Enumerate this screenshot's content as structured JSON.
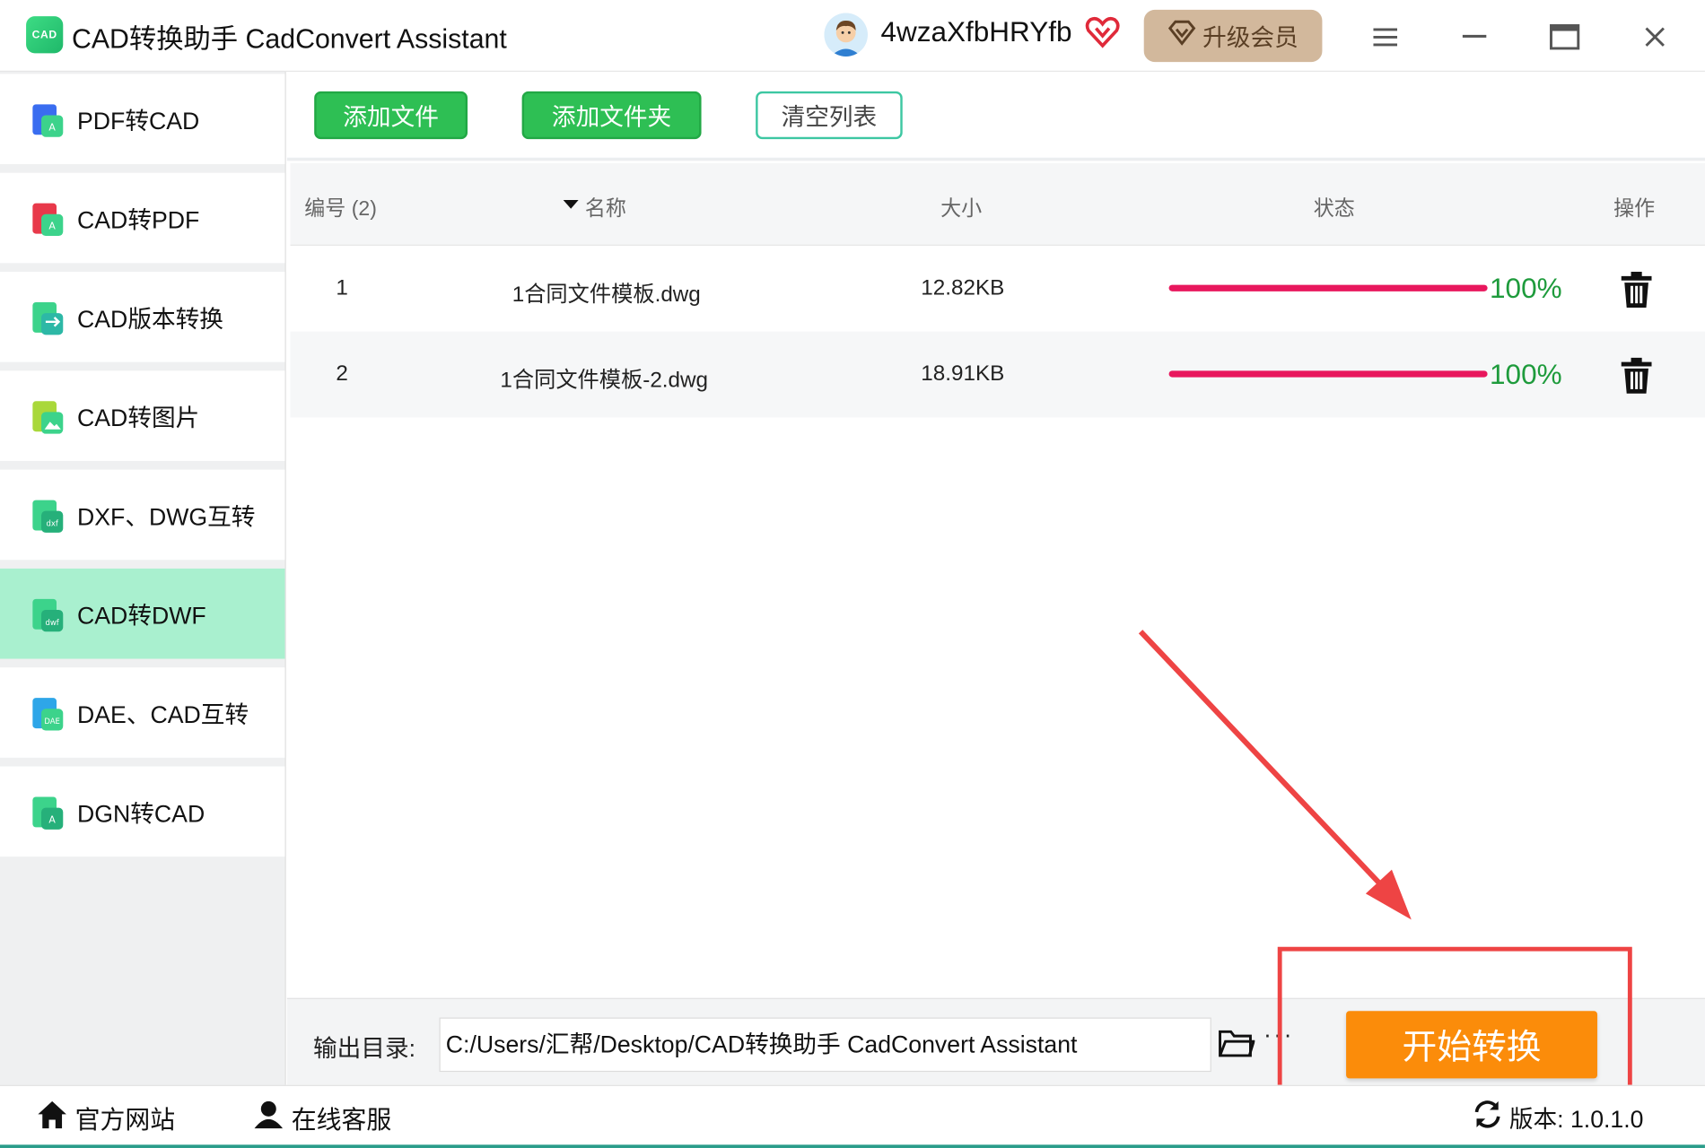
{
  "titlebar": {
    "logo_text": "CAD",
    "title": "CAD转换助手 CadConvert Assistant",
    "username": "4wzaXfbHRYfb",
    "upgrade_label": "升级会员"
  },
  "sidebar": {
    "items": [
      {
        "label": "PDF转CAD",
        "icon": "pdf-to-cad-icon",
        "active": false
      },
      {
        "label": "CAD转PDF",
        "icon": "cad-to-pdf-icon",
        "active": false
      },
      {
        "label": "CAD版本转换",
        "icon": "cad-version-icon",
        "active": false
      },
      {
        "label": "CAD转图片",
        "icon": "cad-to-image-icon",
        "active": false
      },
      {
        "label": "DXF、DWG互转",
        "icon": "dxf-dwg-icon",
        "active": false
      },
      {
        "label": "CAD转DWF",
        "icon": "cad-to-dwf-icon",
        "active": true
      },
      {
        "label": "DAE、CAD互转",
        "icon": "dae-cad-icon",
        "active": false
      },
      {
        "label": "DGN转CAD",
        "icon": "dgn-to-cad-icon",
        "active": false
      }
    ]
  },
  "toolbar": {
    "add_file": "添加文件",
    "add_folder": "添加文件夹",
    "clear_list": "清空列表"
  },
  "table": {
    "columns": {
      "index": "编号 (2)",
      "name": "名称",
      "size": "大小",
      "status": "状态",
      "action": "操作"
    },
    "rows": [
      {
        "index": "1",
        "name": "1合同文件模板.dwg",
        "size": "12.82KB",
        "progress": "100%"
      },
      {
        "index": "2",
        "name": "1合同文件模板-2.dwg",
        "size": "18.91KB",
        "progress": "100%"
      }
    ]
  },
  "output": {
    "label": "输出目录:",
    "path": "C:/Users/汇帮/Desktop/CAD转换助手 CadConvert Assistant",
    "more": "···",
    "start_label": "开始转换"
  },
  "statusbar": {
    "website": "官方网站",
    "support": "在线客服",
    "version": "版本: 1.0.1.0"
  },
  "colors": {
    "accent_green": "#2ebf54",
    "active_sidebar": "#a9f0cf",
    "progress_bar": "#e8175d",
    "progress_text": "#1e9b3c",
    "start_button": "#fb8c0a",
    "annotation_red": "#ee4444"
  }
}
